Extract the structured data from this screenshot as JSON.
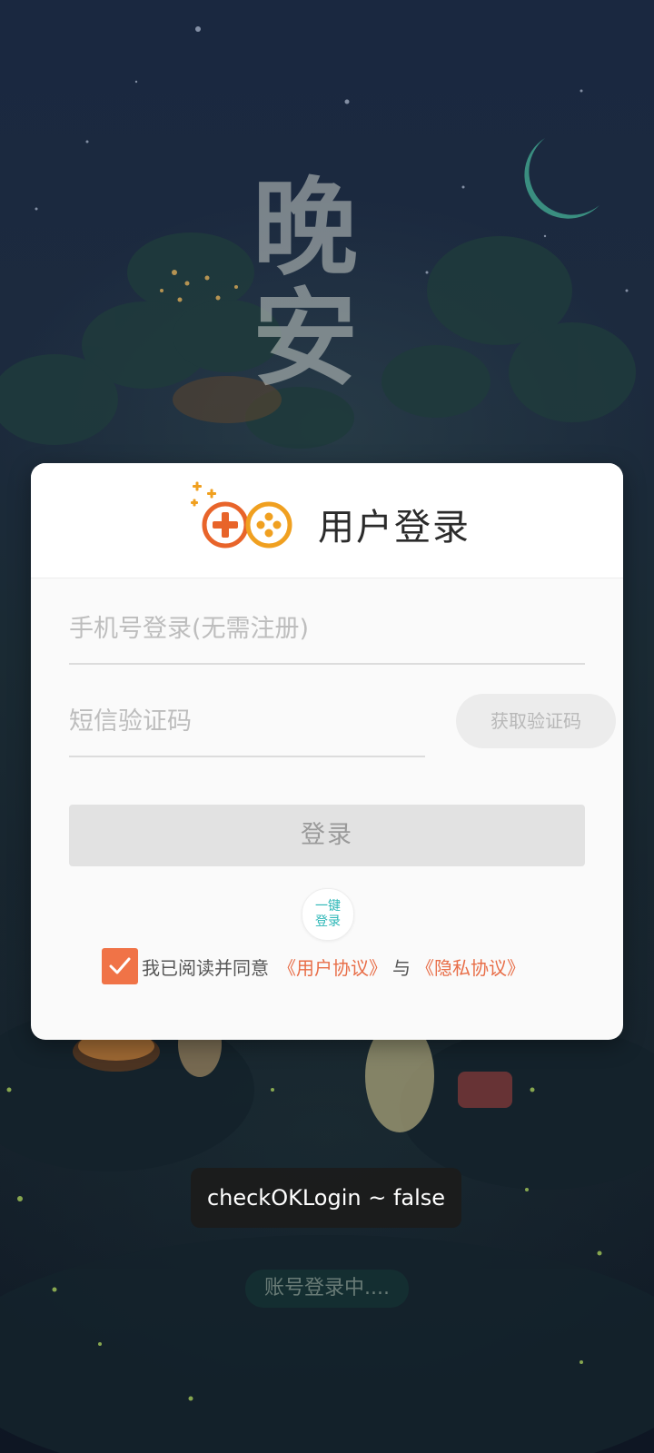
{
  "background": {
    "title_text": "晚安"
  },
  "login": {
    "title": "用户登录",
    "phone_placeholder": "手机号登录(无需注册)",
    "code_placeholder": "短信验证码",
    "get_code_label": "获取验证码",
    "login_label": "登录",
    "one_click_line1": "一键",
    "one_click_line2": "登录",
    "agree_text": "我已阅读并同意",
    "user_agreement": "《用户协议》",
    "and_text": "与",
    "privacy_agreement": "《隐私协议》",
    "agree_checked": true
  },
  "toast": {
    "text": "checkOKLogin ~ false"
  },
  "status": {
    "text": "账号登录中...."
  },
  "colors": {
    "accent": "#f07347",
    "link": "#e86e48",
    "teal": "#2db7b7"
  }
}
